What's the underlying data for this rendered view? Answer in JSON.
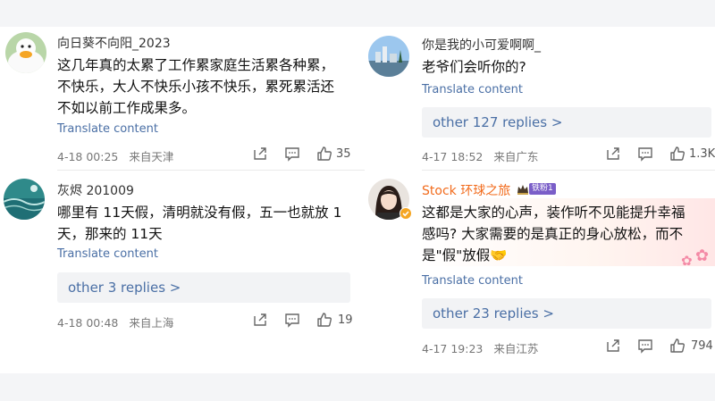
{
  "comments": [
    {
      "username": "向日葵不向阳_2023",
      "lines": [
        "这几年真的太累了工作累家庭生活累各种累，",
        "不快乐，大人不快乐小孩不快乐，累死累活还",
        "不如以前工作成果多。"
      ],
      "translate": "Translate content",
      "date": "4-18 00:25",
      "location": "来自天津",
      "likes": "35"
    },
    {
      "username": "你是我的小可爱啊啊_",
      "lines": [
        "老爷们会听你的?"
      ],
      "translate": "Translate content",
      "replies": "other 127 replies >",
      "date": "4-17 18:52",
      "location": "来自广东",
      "likes": "1.3K"
    },
    {
      "username": "灰烬 201009",
      "lines": [
        "哪里有 11天假，清明就没有假，五一也就放 1",
        "天，那来的 11天"
      ],
      "translate": "Translate content",
      "replies": "other 3 replies >",
      "date": "4-18 00:48",
      "location": "来自上海",
      "likes": "19"
    },
    {
      "username": "Stock 环球之旅",
      "badge": "铁粉1",
      "lines": [
        "这都是大家的心声，装作听不见能提升幸福",
        "感吗? 大家需要的是真正的身心放松，而不",
        "是\"假\"放假🤝"
      ],
      "translate": "Translate content",
      "replies": "other 23 replies >",
      "date": "4-17 19:23",
      "location": "来自江苏",
      "likes": "794"
    }
  ],
  "icons": {
    "share": "share-icon",
    "comment": "comment-icon",
    "like": "like-icon",
    "crown": "crown-icon",
    "flower": "flower-icon"
  },
  "colors": {
    "link": "#4a6fa5",
    "username_highlight": "#f26b1c",
    "badge": "#7a5ec8"
  }
}
